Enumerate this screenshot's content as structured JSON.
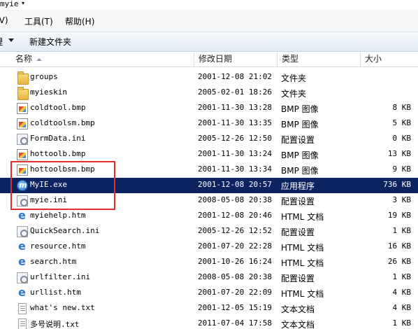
{
  "window": {
    "title": "myie"
  },
  "menu": {
    "items": [
      {
        "label": "(V)"
      },
      {
        "label": "工具(T)"
      },
      {
        "label": "帮助(H)"
      }
    ]
  },
  "toolbar": {
    "organize_label": "理",
    "new_folder_label": "新建文件夹"
  },
  "columns": [
    {
      "label": "名称"
    },
    {
      "label": "修改日期"
    },
    {
      "label": "类型"
    },
    {
      "label": "大小"
    }
  ],
  "files": [
    {
      "name": "groups",
      "date": "2001-12-08 21:02",
      "type": "文件夹",
      "size": "",
      "icon": "folder-icon"
    },
    {
      "name": "myieskin",
      "date": "2005-02-01 18:26",
      "type": "文件夹",
      "size": "",
      "icon": "folder-icon"
    },
    {
      "name": "coldtool.bmp",
      "date": "2001-11-30 13:28",
      "type": "BMP 图像",
      "size": "8 KB",
      "icon": "bmp-icon"
    },
    {
      "name": "coldtoolsm.bmp",
      "date": "2001-11-30 13:35",
      "type": "BMP 图像",
      "size": "5 KB",
      "icon": "bmp-icon"
    },
    {
      "name": "FormData.ini",
      "date": "2005-12-26 12:50",
      "type": "配置设置",
      "size": "0 KB",
      "icon": "ini-icon"
    },
    {
      "name": "hottoolb.bmp",
      "date": "2001-11-30 13:24",
      "type": "BMP 图像",
      "size": "13 KB",
      "icon": "bmp-icon"
    },
    {
      "name": "hottoolbsm.bmp",
      "date": "2001-11-30 13:34",
      "type": "BMP 图像",
      "size": "9 KB",
      "icon": "bmp-icon"
    },
    {
      "name": "MyIE.exe",
      "date": "2001-12-08 20:57",
      "type": "应用程序",
      "size": "736 KB",
      "icon": "exe-icon",
      "selected": true
    },
    {
      "name": "myie.ini",
      "date": "2008-05-08 20:38",
      "type": "配置设置",
      "size": "3 KB",
      "icon": "ini-icon"
    },
    {
      "name": "myiehelp.htm",
      "date": "2001-12-08 20:46",
      "type": "HTML 文档",
      "size": "19 KB",
      "icon": "html-icon"
    },
    {
      "name": "QuickSearch.ini",
      "date": "2005-12-26 12:52",
      "type": "配置设置",
      "size": "1 KB",
      "icon": "ini-icon"
    },
    {
      "name": "resource.htm",
      "date": "2001-07-20 22:28",
      "type": "HTML 文档",
      "size": "16 KB",
      "icon": "html-icon"
    },
    {
      "name": "search.htm",
      "date": "2001-10-26 16:24",
      "type": "HTML 文档",
      "size": "26 KB",
      "icon": "html-icon"
    },
    {
      "name": "urlfilter.ini",
      "date": "2008-05-08 20:38",
      "type": "配置设置",
      "size": "1 KB",
      "icon": "ini-icon"
    },
    {
      "name": "urllist.htm",
      "date": "2001-07-20 22:09",
      "type": "HTML 文档",
      "size": "4 KB",
      "icon": "html-icon"
    },
    {
      "name": "what's new.txt",
      "date": "2001-12-05 15:19",
      "type": "文本文档",
      "size": "4 KB",
      "icon": "text-file-icon"
    },
    {
      "name": "多号说明.txt",
      "date": "2011-07-04 17:58",
      "type": "文本文档",
      "size": "1 KB",
      "icon": "text-file-icon"
    }
  ],
  "colors": {
    "selection": "#0b2461",
    "highlight_box": "#e03030"
  }
}
